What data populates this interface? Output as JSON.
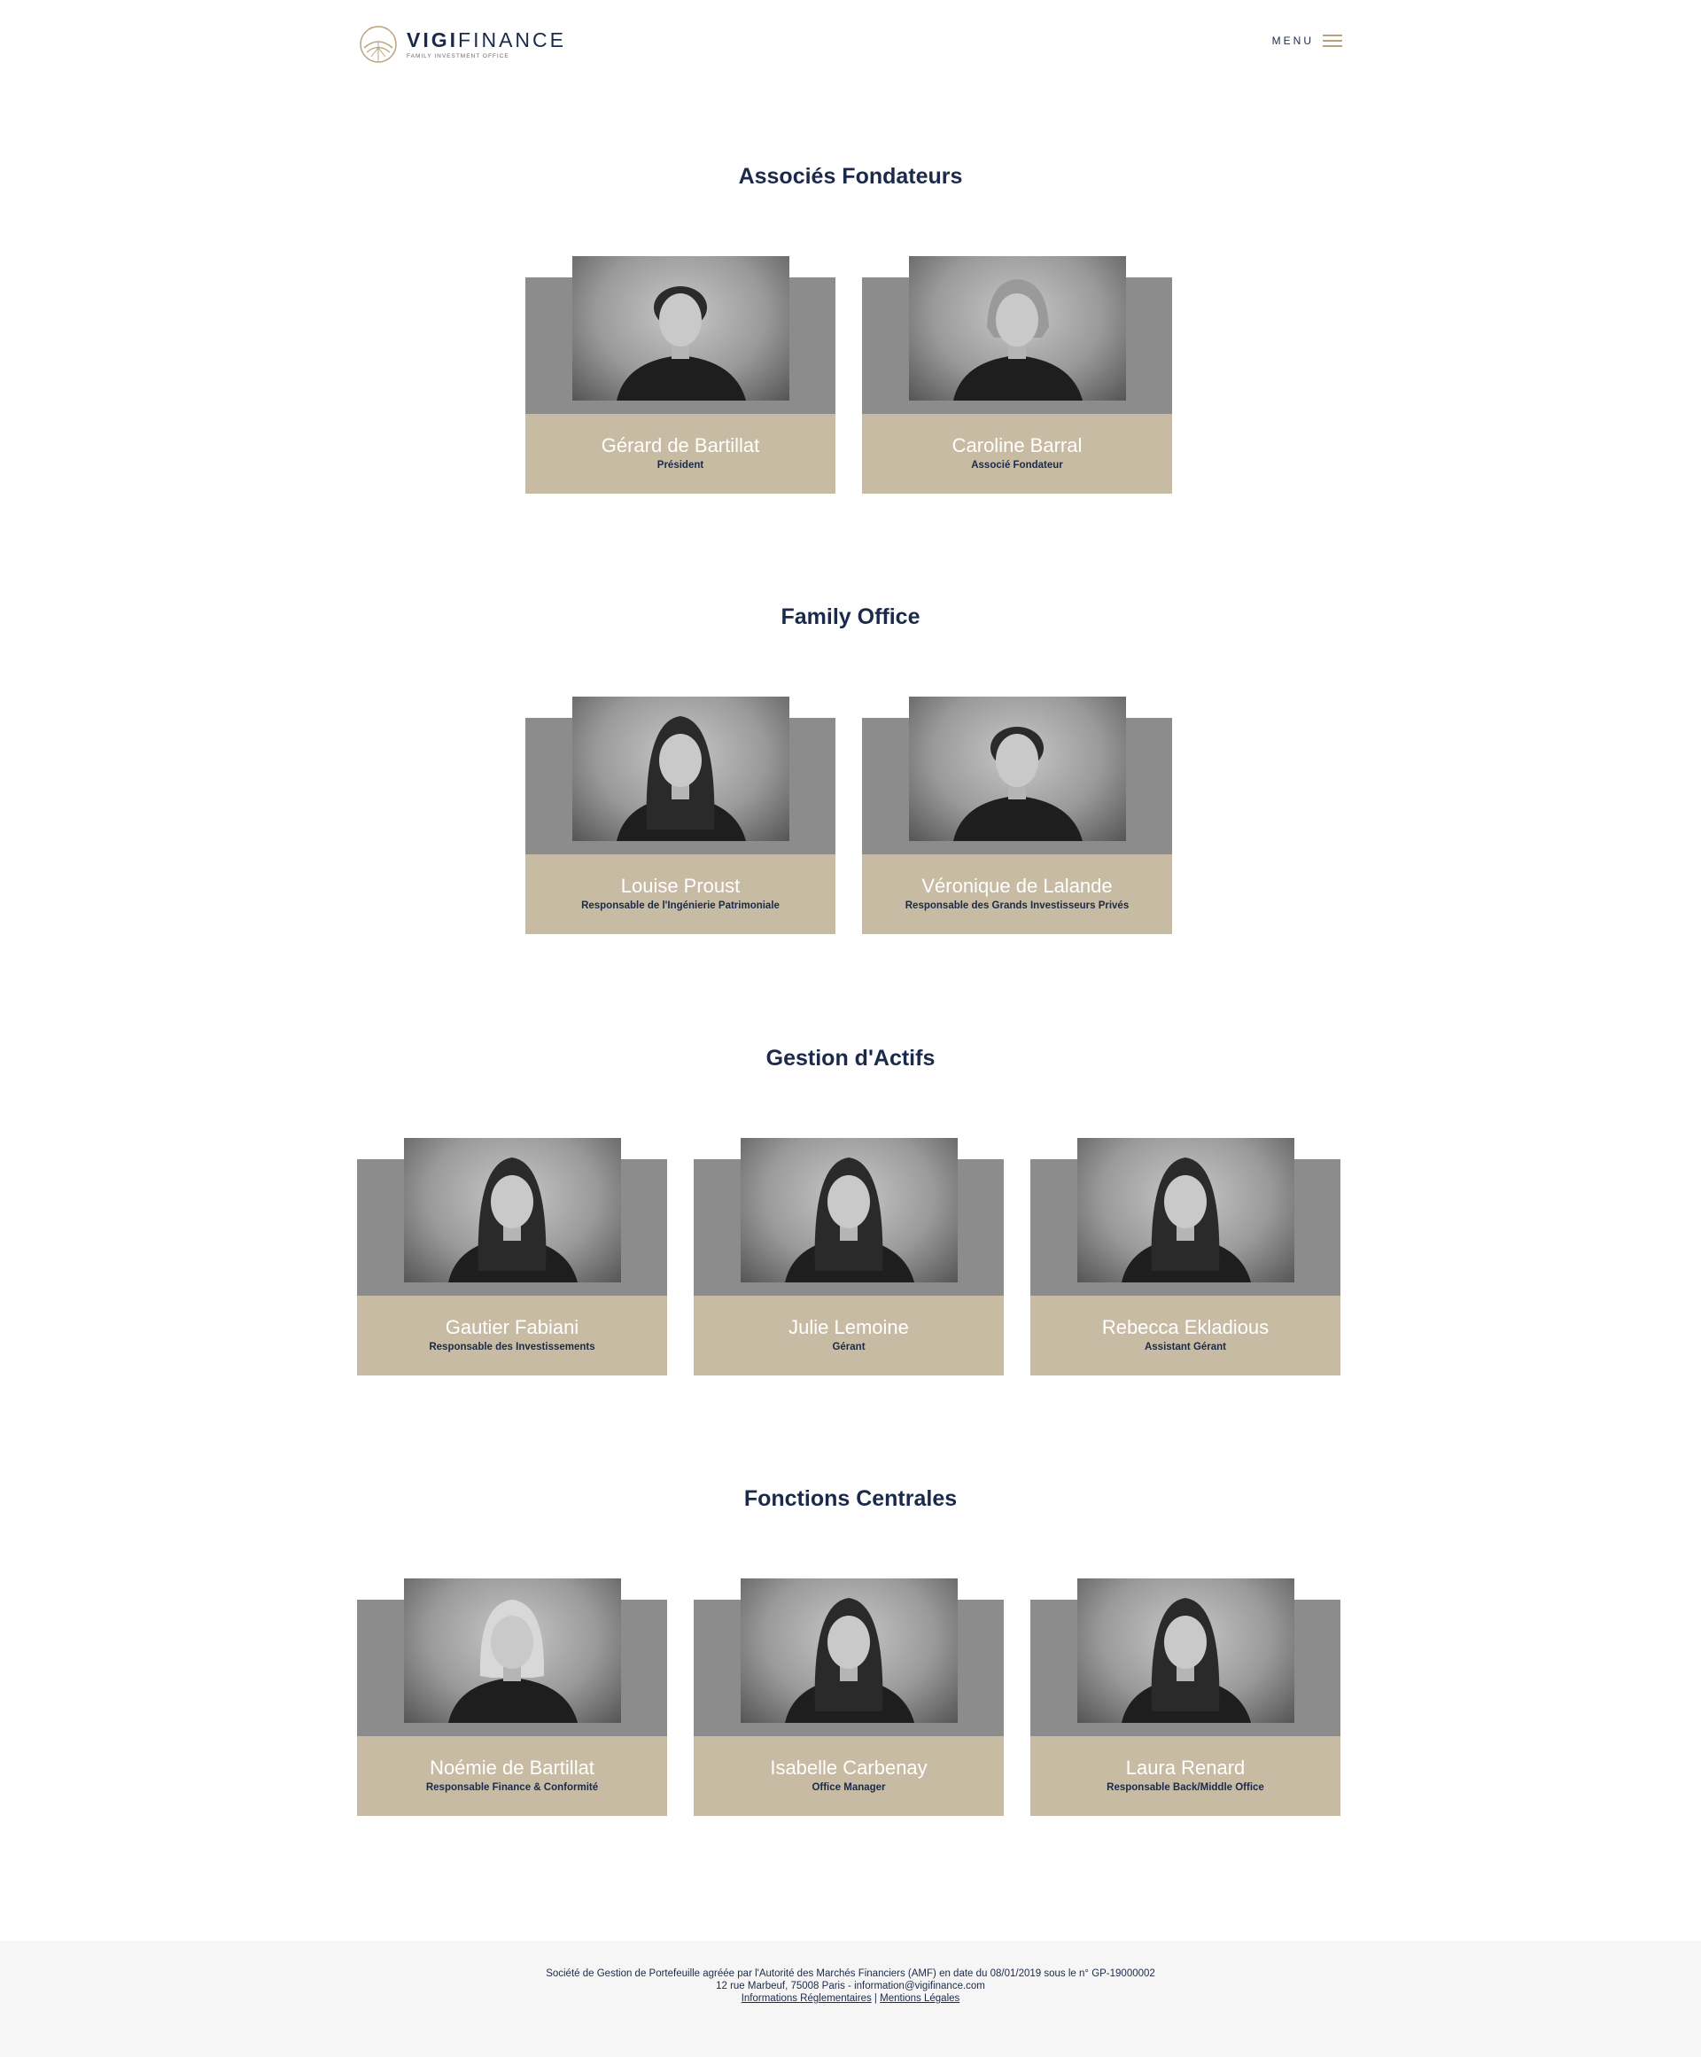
{
  "header": {
    "logo_bold": "VIGI",
    "logo_light": "FINANCE",
    "logo_tagline": "FAMILY INVESTMENT OFFICE",
    "menu_label": "MENU"
  },
  "sections": [
    {
      "title": "Associés Fondateurs",
      "members": [
        {
          "name": "Gérard de Bartillat",
          "role": "Président"
        },
        {
          "name": "Caroline Barral",
          "role": "Associé Fondateur"
        }
      ]
    },
    {
      "title": "Family Office",
      "members": [
        {
          "name": "Louise Proust",
          "role": "Responsable de l'Ingénierie Patrimoniale"
        },
        {
          "name": "Véronique de Lalande",
          "role": "Responsable des Grands Investisseurs Privés"
        }
      ]
    },
    {
      "title": "Gestion d'Actifs",
      "members": [
        {
          "name": "Gautier Fabiani",
          "role": "Responsable des Investissements"
        },
        {
          "name": "Julie Lemoine",
          "role": "Gérant"
        },
        {
          "name": "Rebecca Ekladious",
          "role": "Assistant Gérant"
        }
      ]
    },
    {
      "title": "Fonctions Centrales",
      "members": [
        {
          "name": "Noémie de Bartillat",
          "role": "Responsable Finance & Conformité"
        },
        {
          "name": "Isabelle Carbenay",
          "role": "Office Manager"
        },
        {
          "name": "Laura Renard",
          "role": "Responsable Back/Middle Office"
        }
      ]
    }
  ],
  "footer": {
    "line1": "Société de Gestion de Portefeuille agréée par l'Autorité des Marchés Financiers (AMF) en date du 08/01/2019 sous le n° GP-19000002",
    "line2": "12 rue Marbeuf, 75008 Paris - information@vigifinance.com",
    "link_regulatory": "Informations Réglementaires",
    "separator": "|",
    "link_legal": "Mentions Légales"
  },
  "colors": {
    "navy": "#1b2a4a",
    "gold": "#b9a37e",
    "card_grey": "#8c8c8c",
    "card_beige": "#c8bba3",
    "footer_bg": "#f6f6f6"
  }
}
